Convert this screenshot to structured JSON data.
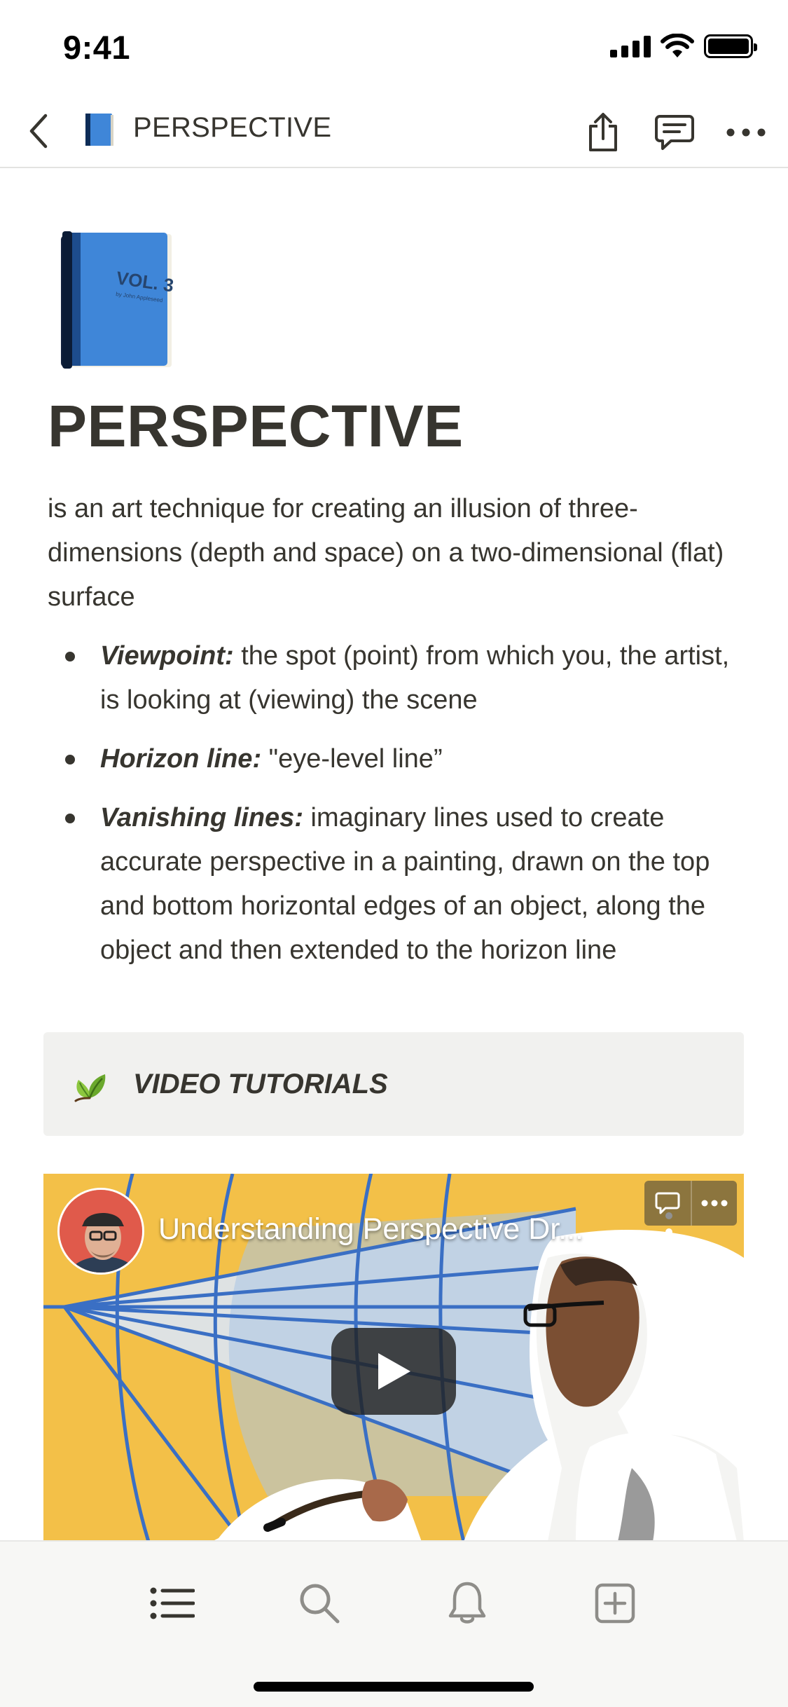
{
  "status_bar": {
    "time": "9:41"
  },
  "nav": {
    "title": "PERSPECTIVE"
  },
  "page": {
    "title": "PERSPECTIVE",
    "intro": "is an art technique for creating an illusion of three-dimensions (depth and space) on a two-dimensional (flat) surface",
    "bullets": [
      {
        "term": "Viewpoint:",
        "text": " the spot (point) from which you, the artist, is looking at (viewing) the scene"
      },
      {
        "term": "Horizon line:",
        "text": " \"eye-level line”"
      },
      {
        "term": "Vanishing lines:",
        "text": " imaginary lines used to create accurate perspective in a painting, drawn on the top and bottom horizontal edges of an object, along the object and then extended to the horizon line"
      }
    ],
    "callout": {
      "icon": "leaf-icon",
      "text": "VIDEO TUTORIALS"
    }
  },
  "video": {
    "title": "Understanding Perspective Dr..."
  },
  "tab_bar": {
    "items": [
      "list-icon",
      "search-icon",
      "bell-icon",
      "new-page-icon"
    ]
  },
  "colors": {
    "text": "#37352f",
    "callout_bg": "#f1f1ef",
    "video_bg": "#f3c048",
    "book_blue": "#3f86d8"
  }
}
